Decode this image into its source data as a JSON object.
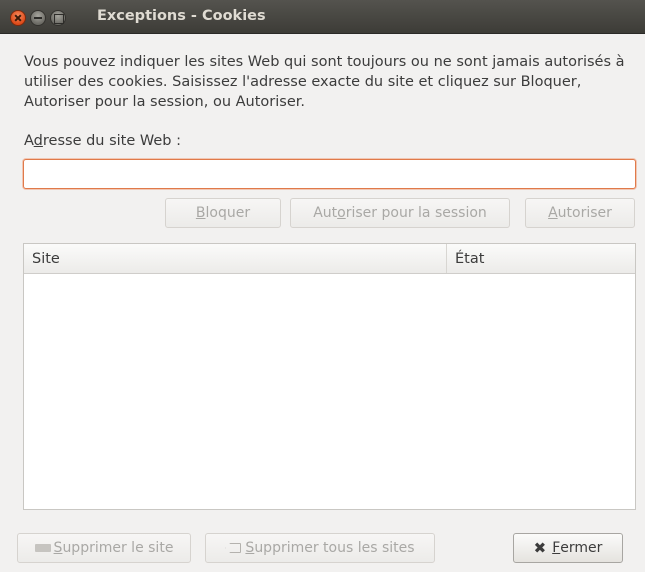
{
  "window": {
    "title": "Exceptions - Cookies",
    "controls": {
      "close": "close-icon",
      "minimize": "minimize-icon",
      "maximize": "maximize-icon"
    }
  },
  "description": "Vous pouvez indiquer les sites Web qui sont toujours ou ne sont jamais autorisés à utiliser des cookies. Saisissez l'adresse exacte du site et cliquez sur Bloquer, Autoriser pour la session, ou Autoriser.",
  "address": {
    "label_pre": "A",
    "label_key": "d",
    "label_post": "resse du site Web :",
    "value": ""
  },
  "buttons": {
    "block": {
      "pre": "",
      "key": "B",
      "post": "loquer"
    },
    "allow_session": {
      "pre": "Aut",
      "key": "o",
      "post": "riser pour la session"
    },
    "allow": {
      "pre": "",
      "key": "A",
      "post": "utoriser"
    },
    "remove_site": {
      "pre": "",
      "key": "S",
      "post": "upprimer le site"
    },
    "remove_all": {
      "pre": "",
      "key": "S",
      "post": "upprimer tous les sites"
    },
    "close": {
      "pre": "",
      "key": "F",
      "post": "ermer"
    }
  },
  "table": {
    "columns": [
      "Site",
      "État"
    ],
    "rows": []
  },
  "colors": {
    "titlebar": "#3d3c37",
    "title_text": "#dfdbd2",
    "window_bg": "#f2f1f0",
    "focus_border": "#e07a4a",
    "close_button": "#de4a19"
  }
}
